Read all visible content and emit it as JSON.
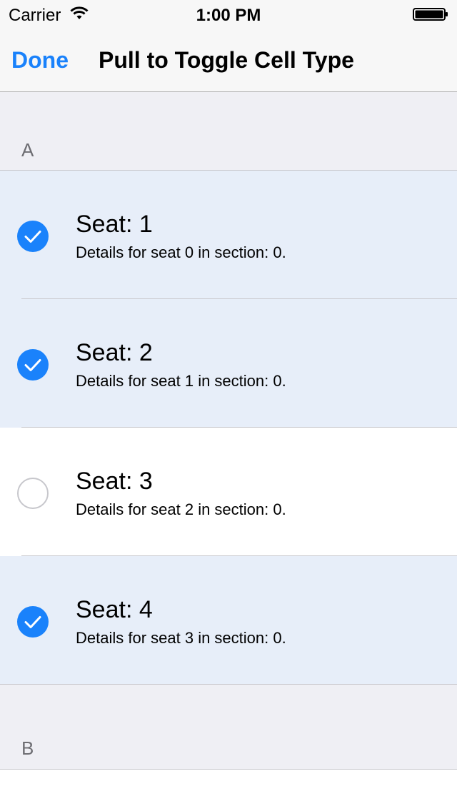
{
  "status_bar": {
    "carrier": "Carrier",
    "time": "1:00 PM"
  },
  "nav": {
    "done_label": "Done",
    "title": "Pull to Toggle Cell Type"
  },
  "sections": [
    {
      "header": "A",
      "rows": [
        {
          "title": "Seat: 1",
          "detail": "Details for seat 0 in section: 0.",
          "selected": true
        },
        {
          "title": "Seat: 2",
          "detail": "Details for seat 1 in section: 0.",
          "selected": true
        },
        {
          "title": "Seat: 3",
          "detail": "Details for seat 2 in section: 0.",
          "selected": false
        },
        {
          "title": "Seat: 4",
          "detail": "Details for seat 3 in section: 0.",
          "selected": true
        }
      ]
    },
    {
      "header": "B",
      "rows": []
    }
  ],
  "colors": {
    "accent": "#1a82fb",
    "selected_row": "#e7eef9",
    "grouped_background": "#efeff4"
  }
}
